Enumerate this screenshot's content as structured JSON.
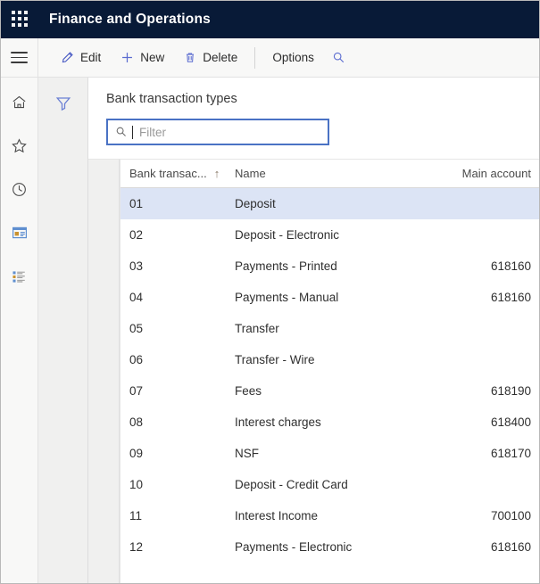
{
  "header": {
    "waffle_icon": "waffle-grid-icon",
    "title": "Finance and Operations"
  },
  "toolbar": {
    "menu_icon": "hamburger-menu-icon",
    "edit_label": "Edit",
    "edit_icon": "pencil-icon",
    "new_label": "New",
    "new_icon": "plus-icon",
    "delete_label": "Delete",
    "delete_icon": "trash-icon",
    "options_label": "Options",
    "search_icon": "magnifier-icon"
  },
  "navrail": {
    "items": [
      {
        "icon": "home-icon",
        "name": "home"
      },
      {
        "icon": "star-icon",
        "name": "favorites"
      },
      {
        "icon": "clock-icon",
        "name": "recent"
      },
      {
        "icon": "workspace-icon",
        "name": "workspaces"
      },
      {
        "icon": "list-icon",
        "name": "modules"
      }
    ]
  },
  "filter_pane": {
    "filter_icon": "funnel-icon"
  },
  "page": {
    "title": "Bank transaction types"
  },
  "search": {
    "icon": "magnifier-icon",
    "value": "",
    "placeholder": "Filter"
  },
  "grid": {
    "columns": [
      {
        "label": "Bank transac...",
        "sort": "↑"
      },
      {
        "label": "Name",
        "sort": ""
      },
      {
        "label": "Main account",
        "sort": ""
      }
    ],
    "rows": [
      {
        "code": "01",
        "name": "Deposit",
        "account": "",
        "selected": true
      },
      {
        "code": "02",
        "name": "Deposit - Electronic",
        "account": "",
        "selected": false
      },
      {
        "code": "03",
        "name": "Payments - Printed",
        "account": "618160",
        "selected": false
      },
      {
        "code": "04",
        "name": "Payments - Manual",
        "account": "618160",
        "selected": false
      },
      {
        "code": "05",
        "name": "Transfer",
        "account": "",
        "selected": false
      },
      {
        "code": "06",
        "name": "Transfer - Wire",
        "account": "",
        "selected": false
      },
      {
        "code": "07",
        "name": "Fees",
        "account": "618190",
        "selected": false
      },
      {
        "code": "08",
        "name": "Interest charges",
        "account": "618400",
        "selected": false
      },
      {
        "code": "09",
        "name": "NSF",
        "account": "618170",
        "selected": false
      },
      {
        "code": "10",
        "name": "Deposit - Credit Card",
        "account": "",
        "selected": false
      },
      {
        "code": "11",
        "name": "Interest Income",
        "account": "700100",
        "selected": false
      },
      {
        "code": "12",
        "name": "Payments - Electronic",
        "account": "618160",
        "selected": false
      }
    ]
  },
  "colors": {
    "header_bg": "#081a37",
    "accent": "#4a5bc4",
    "focus_border": "#4a72c4",
    "selected_row": "#dce4f5",
    "toolbar_bg": "#f8f8f7"
  }
}
